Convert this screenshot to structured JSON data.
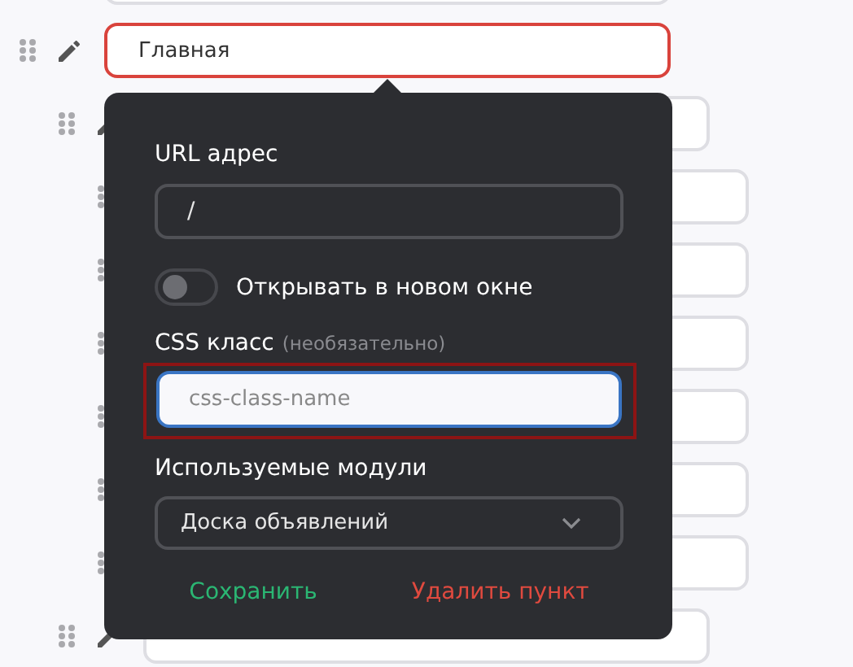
{
  "menu_items": [
    {
      "selected": false
    },
    {
      "label": "Главная",
      "selected": true,
      "children": [
        {
          "selected": false,
          "children": [
            {
              "selected": false
            },
            {
              "selected": false
            },
            {
              "selected": false
            },
            {
              "selected": false
            },
            {
              "selected": false
            },
            {
              "selected": false
            }
          ]
        },
        {
          "selected": false
        }
      ]
    }
  ],
  "popover": {
    "url_label": "URL адрес",
    "url_value": "/",
    "new_window": {
      "label": "Открывать в новом окне",
      "on": false
    },
    "css_label": "CSS класс",
    "css_hint": "(необязательно)",
    "css_placeholder": "css-class-name",
    "css_highlighted": true,
    "modules_label": "Используемые модули",
    "modules_value": "Доска объявлений",
    "save": "Сохранить",
    "delete": "Удалить пункт"
  }
}
